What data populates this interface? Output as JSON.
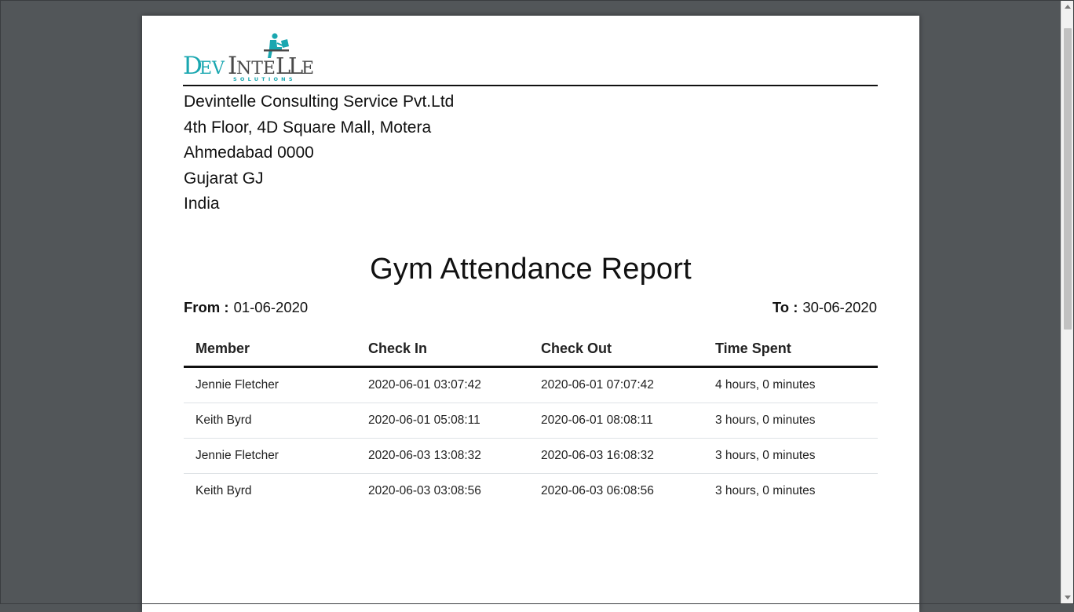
{
  "logo": {
    "wordmark": "DevIntelle",
    "tagline": "SOLUTIONS",
    "colors": {
      "teal": "#1aa7b0",
      "gray": "#4a4a4a"
    }
  },
  "company": {
    "name": "Devintelle Consulting Service Pvt.Ltd",
    "address_line1": "4th Floor, 4D Square Mall, Motera",
    "city_line": "Ahmedabad 0000",
    "state_line": "Gujarat GJ",
    "country": "India"
  },
  "report": {
    "title": "Gym Attendance Report",
    "from_label": "From :",
    "from_value": "01-06-2020",
    "to_label": "To :",
    "to_value": "30-06-2020"
  },
  "table": {
    "headers": [
      "Member",
      "Check In",
      "Check Out",
      "Time Spent"
    ],
    "rows": [
      [
        "Jennie Fletcher",
        "2020-06-01 03:07:42",
        "2020-06-01 07:07:42",
        "4 hours, 0 minutes"
      ],
      [
        "Keith Byrd",
        "2020-06-01 05:08:11",
        "2020-06-01 08:08:11",
        "3 hours, 0 minutes"
      ],
      [
        "Jennie Fletcher",
        "2020-06-03 13:08:32",
        "2020-06-03 16:08:32",
        "3 hours, 0 minutes"
      ],
      [
        "Keith Byrd",
        "2020-06-03 03:08:56",
        "2020-06-03 06:08:56",
        "3 hours, 0 minutes"
      ]
    ]
  },
  "viewer": {
    "background": "#525659",
    "scrollbar_icons": [
      "scroll-up-arrow-icon",
      "scroll-down-arrow-icon"
    ]
  }
}
